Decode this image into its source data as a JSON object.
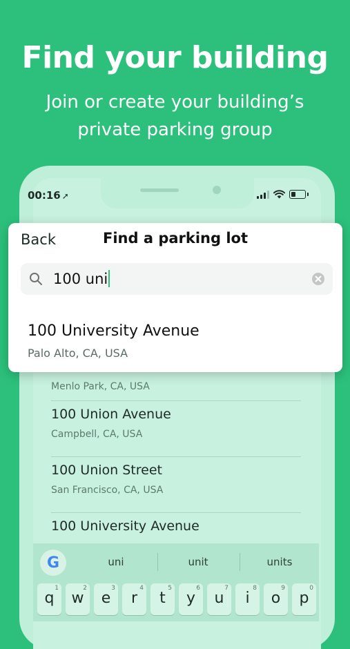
{
  "hero": {
    "title": "Find your building",
    "subtitle": "Join or create your building’s private parking group"
  },
  "status_bar": {
    "time": "00:16",
    "icons": [
      "location-arrow-icon",
      "signal-icon",
      "wifi-icon",
      "battery-icon"
    ]
  },
  "search_card": {
    "back_label": "Back",
    "title": "Find a parking lot",
    "search_value": "100 uni",
    "top_result": {
      "name": "100 University Avenue",
      "location": "Palo Alto, CA, USA"
    }
  },
  "results": [
    {
      "name": "",
      "location": "Menlo Park, CA, USA"
    },
    {
      "name": "100 Union Avenue",
      "location": "Campbell, CA, USA"
    },
    {
      "name": "100 Union Street",
      "location": "San Francisco, CA, USA"
    },
    {
      "name": "100 University Avenue",
      "location": ""
    }
  ],
  "keyboard": {
    "suggestions": [
      "uni",
      "unit",
      "units"
    ],
    "row1": [
      {
        "key": "q",
        "num": "1"
      },
      {
        "key": "w",
        "num": "2"
      },
      {
        "key": "e",
        "num": "3"
      },
      {
        "key": "r",
        "num": "4"
      },
      {
        "key": "t",
        "num": "5"
      },
      {
        "key": "y",
        "num": "6"
      },
      {
        "key": "u",
        "num": "7"
      },
      {
        "key": "i",
        "num": "8"
      },
      {
        "key": "o",
        "num": "9"
      },
      {
        "key": "p",
        "num": "0"
      }
    ],
    "logo_letter": "G"
  },
  "colors": {
    "brand_green": "#2cc07c",
    "phone_body": "#bfeed9",
    "screen": "#c8f1df",
    "caret": "#2cc07c"
  }
}
